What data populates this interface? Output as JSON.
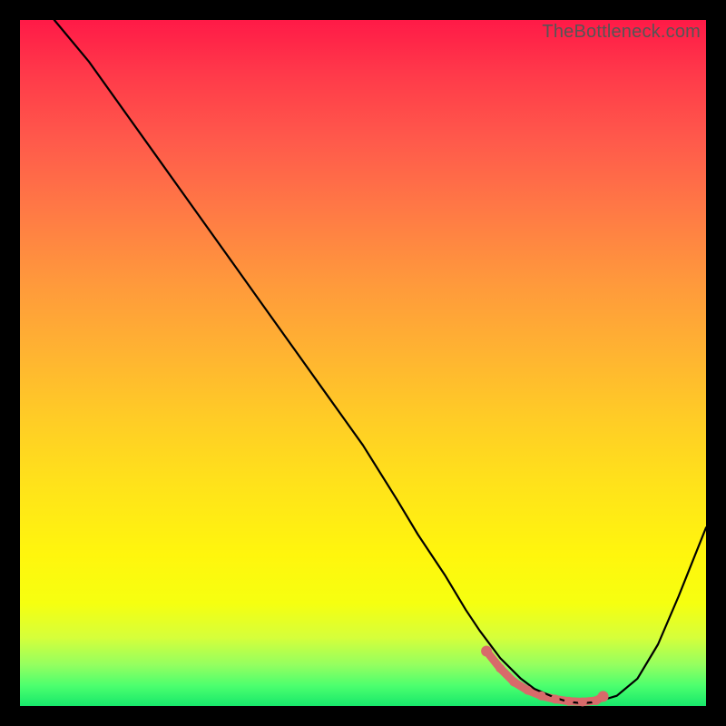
{
  "watermark": "TheBottleneck.com",
  "colors": {
    "background": "#000000",
    "curve": "#000000",
    "band": "#d86a6a",
    "gradient_top": "#ff1a47",
    "gradient_bottom": "#17e86b"
  },
  "chart_data": {
    "type": "line",
    "title": "",
    "xlabel": "",
    "ylabel": "",
    "xlim": [
      0,
      100
    ],
    "ylim": [
      0,
      100
    ],
    "grid": false,
    "legend": false,
    "annotations": [],
    "series": [
      {
        "name": "bottleneck-curve",
        "x": [
          5,
          10,
          15,
          20,
          25,
          30,
          35,
          40,
          45,
          50,
          55,
          58,
          62,
          65,
          67,
          70,
          73,
          75,
          78,
          80,
          82,
          84,
          87,
          90,
          93,
          96,
          100
        ],
        "y": [
          100,
          94,
          87,
          80,
          73,
          66,
          59,
          52,
          45,
          38,
          30,
          25,
          19,
          14,
          11,
          7,
          4,
          2.5,
          1.2,
          0.6,
          0.4,
          0.6,
          1.5,
          4,
          9,
          16,
          26
        ]
      }
    ],
    "optimal_band": {
      "x_start": 68,
      "x_end": 85,
      "dots_x": [
        68,
        70,
        72,
        74,
        76,
        78,
        80,
        82,
        84,
        85
      ],
      "dots_y": [
        8,
        5.5,
        3.5,
        2.3,
        1.5,
        1.0,
        0.7,
        0.6,
        0.8,
        1.4
      ]
    }
  }
}
